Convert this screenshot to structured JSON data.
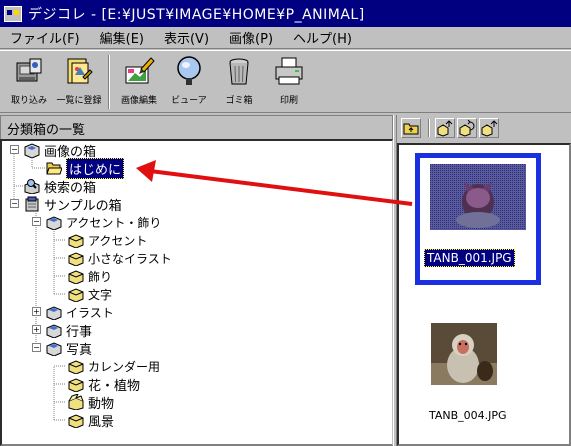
{
  "window": {
    "title": "デジコレ - [E:¥JUST¥IMAGE¥HOME¥P_ANIMAL]"
  },
  "menu": [
    {
      "label": "ファイル(F)"
    },
    {
      "label": "編集(E)"
    },
    {
      "label": "表示(V)"
    },
    {
      "label": "画像(P)"
    },
    {
      "label": "ヘルプ(H)"
    }
  ],
  "toolbar": {
    "buttons": [
      {
        "label": "取り込み",
        "icon": "scanner-icon"
      },
      {
        "label": "一覧に登録",
        "icon": "register-list-icon"
      },
      {
        "label": "画像編集",
        "icon": "image-edit-icon"
      },
      {
        "label": "ビューア",
        "icon": "magnifier-icon"
      },
      {
        "label": "ゴミ箱",
        "icon": "trash-icon"
      },
      {
        "label": "印刷",
        "icon": "printer-icon"
      }
    ]
  },
  "left_panel": {
    "title": "分類箱の一覧",
    "tree": [
      {
        "label": "画像の箱",
        "level": 0,
        "expander": "−"
      },
      {
        "label": "はじめに",
        "level": 1,
        "selected": true
      },
      {
        "label": "検索の箱",
        "level": 0
      },
      {
        "label": "サンプルの箱",
        "level": 0,
        "expander": "−"
      },
      {
        "label": "アクセント・飾り",
        "level": 1,
        "expander": "−"
      },
      {
        "label": "アクセント",
        "level": 2
      },
      {
        "label": "小さなイラスト",
        "level": 2
      },
      {
        "label": "飾り",
        "level": 2
      },
      {
        "label": "文字",
        "level": 2
      },
      {
        "label": "イラスト",
        "level": 1,
        "expander": "+"
      },
      {
        "label": "行事",
        "level": 1,
        "expander": "+"
      },
      {
        "label": "写真",
        "level": 1,
        "expander": "−"
      },
      {
        "label": "カレンダー用",
        "level": 2
      },
      {
        "label": "花・植物",
        "level": 2
      },
      {
        "label": "動物",
        "level": 2
      },
      {
        "label": "風景",
        "level": 2
      }
    ]
  },
  "right_panel": {
    "toolbar_icons": [
      "up-folder-icon",
      "move-icon",
      "copy-icon",
      "export-icon"
    ],
    "thumbnails": [
      {
        "caption": "TANB_001.JPG",
        "selected": true,
        "subject": "cat"
      },
      {
        "caption": "TANB_004.JPG",
        "selected": false,
        "subject": "monkey"
      }
    ]
  },
  "colors": {
    "title_bar": "#000080",
    "selection": "#000080",
    "highlight_frame": "#1a2fe0",
    "annotation_arrow": "#e01010"
  }
}
